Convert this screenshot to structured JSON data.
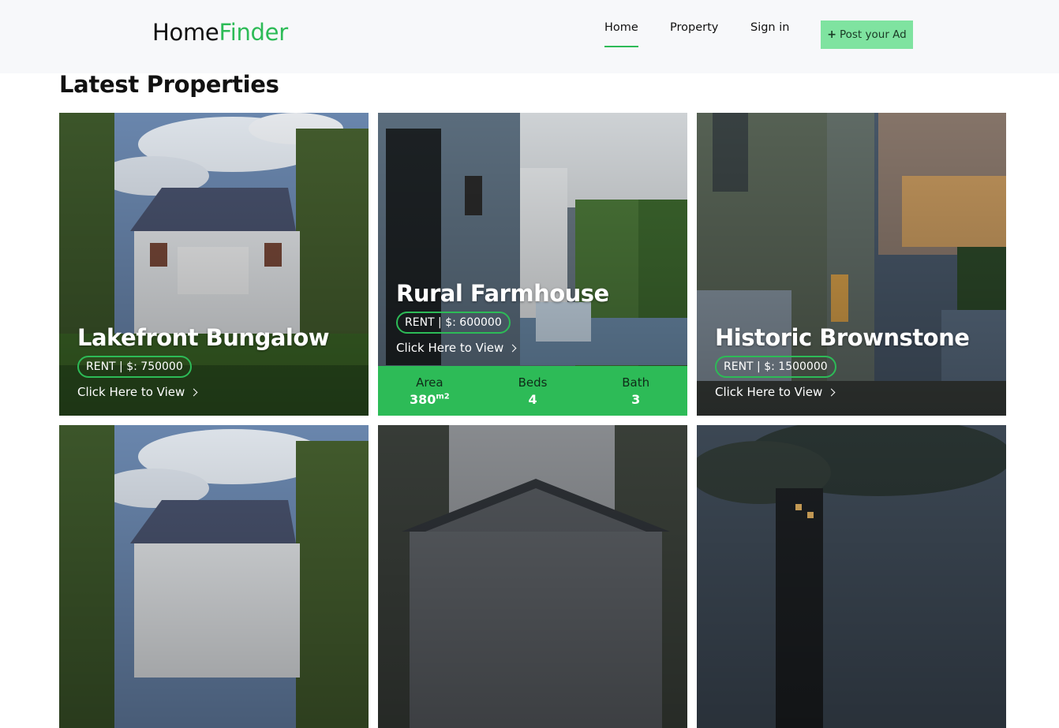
{
  "brand": {
    "name_part1": "Home",
    "name_part2": "Finder",
    "accent_color": "#2dbb57"
  },
  "nav": {
    "home": "Home",
    "property": "Property",
    "signin": "Sign in",
    "post_ad_icon": "+",
    "post_ad": "Post your Ad"
  },
  "section_title": "Latest Properties",
  "cards": [
    {
      "title": "Lakefront Bungalow",
      "badge": "RENT | $: 750000",
      "view": "Click Here to View",
      "image": "white-victorian-house-icon"
    },
    {
      "title": "Rural Farmhouse",
      "badge": "RENT | $: 600000",
      "view": "Click Here to View",
      "image": "porch-with-rocking-chair-icon",
      "stats": {
        "area_label": "Area",
        "area_value": "380",
        "area_unit": "m2",
        "beds_label": "Beds",
        "beds_value": "4",
        "bath_label": "Bath",
        "bath_value": "3"
      }
    },
    {
      "title": "Historic Brownstone",
      "badge": "RENT | $: 1500000",
      "view": "Click Here to View",
      "image": "modern-house-dusk-icon"
    },
    {
      "image": "white-victorian-house-icon"
    },
    {
      "image": "gable-roof-house-icon"
    },
    {
      "image": "modern-house-trees-night-icon"
    }
  ]
}
